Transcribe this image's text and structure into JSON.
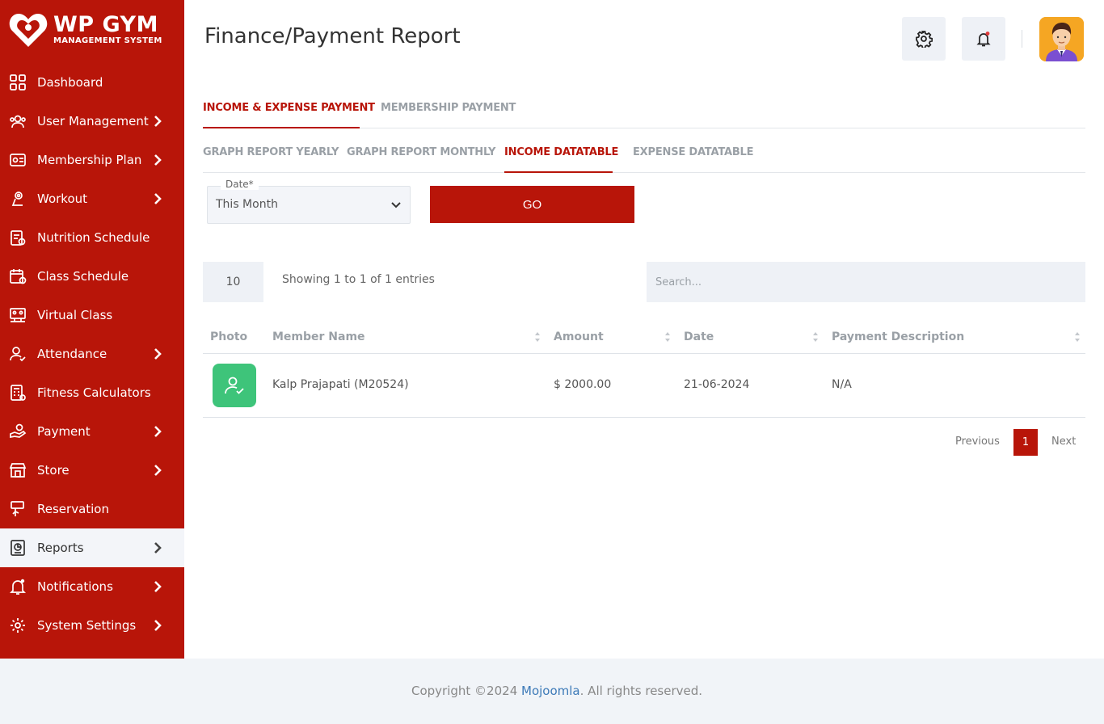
{
  "brand": {
    "title": "WP GYM",
    "subtitle": "MANAGEMENT SYSTEM",
    "color": "#b81509"
  },
  "sidebar": {
    "items": [
      {
        "label": "Dashboard",
        "icon": "dashboard-icon",
        "has_submenu": false
      },
      {
        "label": "User Management",
        "icon": "users-icon",
        "has_submenu": true
      },
      {
        "label": "Membership Plan",
        "icon": "membership-card-icon",
        "has_submenu": true
      },
      {
        "label": "Workout",
        "icon": "workout-icon",
        "has_submenu": true
      },
      {
        "label": "Nutrition Schedule",
        "icon": "nutrition-icon",
        "has_submenu": false
      },
      {
        "label": "Class Schedule",
        "icon": "calendar-icon",
        "has_submenu": false
      },
      {
        "label": "Virtual Class",
        "icon": "virtual-class-icon",
        "has_submenu": false
      },
      {
        "label": "Attendance",
        "icon": "attendance-icon",
        "has_submenu": true
      },
      {
        "label": "Fitness Calculators",
        "icon": "calculator-icon",
        "has_submenu": false
      },
      {
        "label": "Payment",
        "icon": "payment-icon",
        "has_submenu": true
      },
      {
        "label": "Store",
        "icon": "store-icon",
        "has_submenu": true
      },
      {
        "label": "Reservation",
        "icon": "reservation-icon",
        "has_submenu": false
      },
      {
        "label": "Reports",
        "icon": "reports-icon",
        "has_submenu": true,
        "active": true
      },
      {
        "label": "Notifications",
        "icon": "bell-icon",
        "has_submenu": true
      },
      {
        "label": "System Settings",
        "icon": "gear-icon",
        "has_submenu": true
      }
    ]
  },
  "header": {
    "title": "Finance/Payment Report",
    "settings_icon": "gear-icon",
    "notification_icon": "bell-icon",
    "avatar_icon": "user-avatar"
  },
  "tabs_primary": [
    {
      "label": "INCOME & EXPENSE PAYMENT",
      "active": true
    },
    {
      "label": "MEMBERSHIP PAYMENT",
      "active": false
    }
  ],
  "tabs_secondary": [
    {
      "label": "GRAPH REPORT YEARLY",
      "active": false
    },
    {
      "label": "GRAPH REPORT MONTHLY",
      "active": false
    },
    {
      "label": "INCOME DATATABLE",
      "active": true
    },
    {
      "label": "EXPENSE DATATABLE",
      "active": false
    }
  ],
  "filter": {
    "date_label": "Date*",
    "date_value": "This Month",
    "go_label": "GO"
  },
  "table": {
    "page_length": "10",
    "info": "Showing 1 to 1 of 1 entries",
    "search_placeholder": "Search...",
    "columns": [
      "Photo",
      "Member Name",
      "Amount",
      "Date",
      "Payment Description"
    ],
    "rows": [
      {
        "member_name": "Kalp Prajapati (M20524)",
        "amount": "$ 2000.00",
        "date": "21-06-2024",
        "description": "N/A"
      }
    ]
  },
  "pagination": {
    "previous": "Previous",
    "current": "1",
    "next": "Next"
  },
  "footer": {
    "prefix": "Copyright ©2024 ",
    "link": "Mojoomla",
    "suffix": ". All rights reserved."
  }
}
